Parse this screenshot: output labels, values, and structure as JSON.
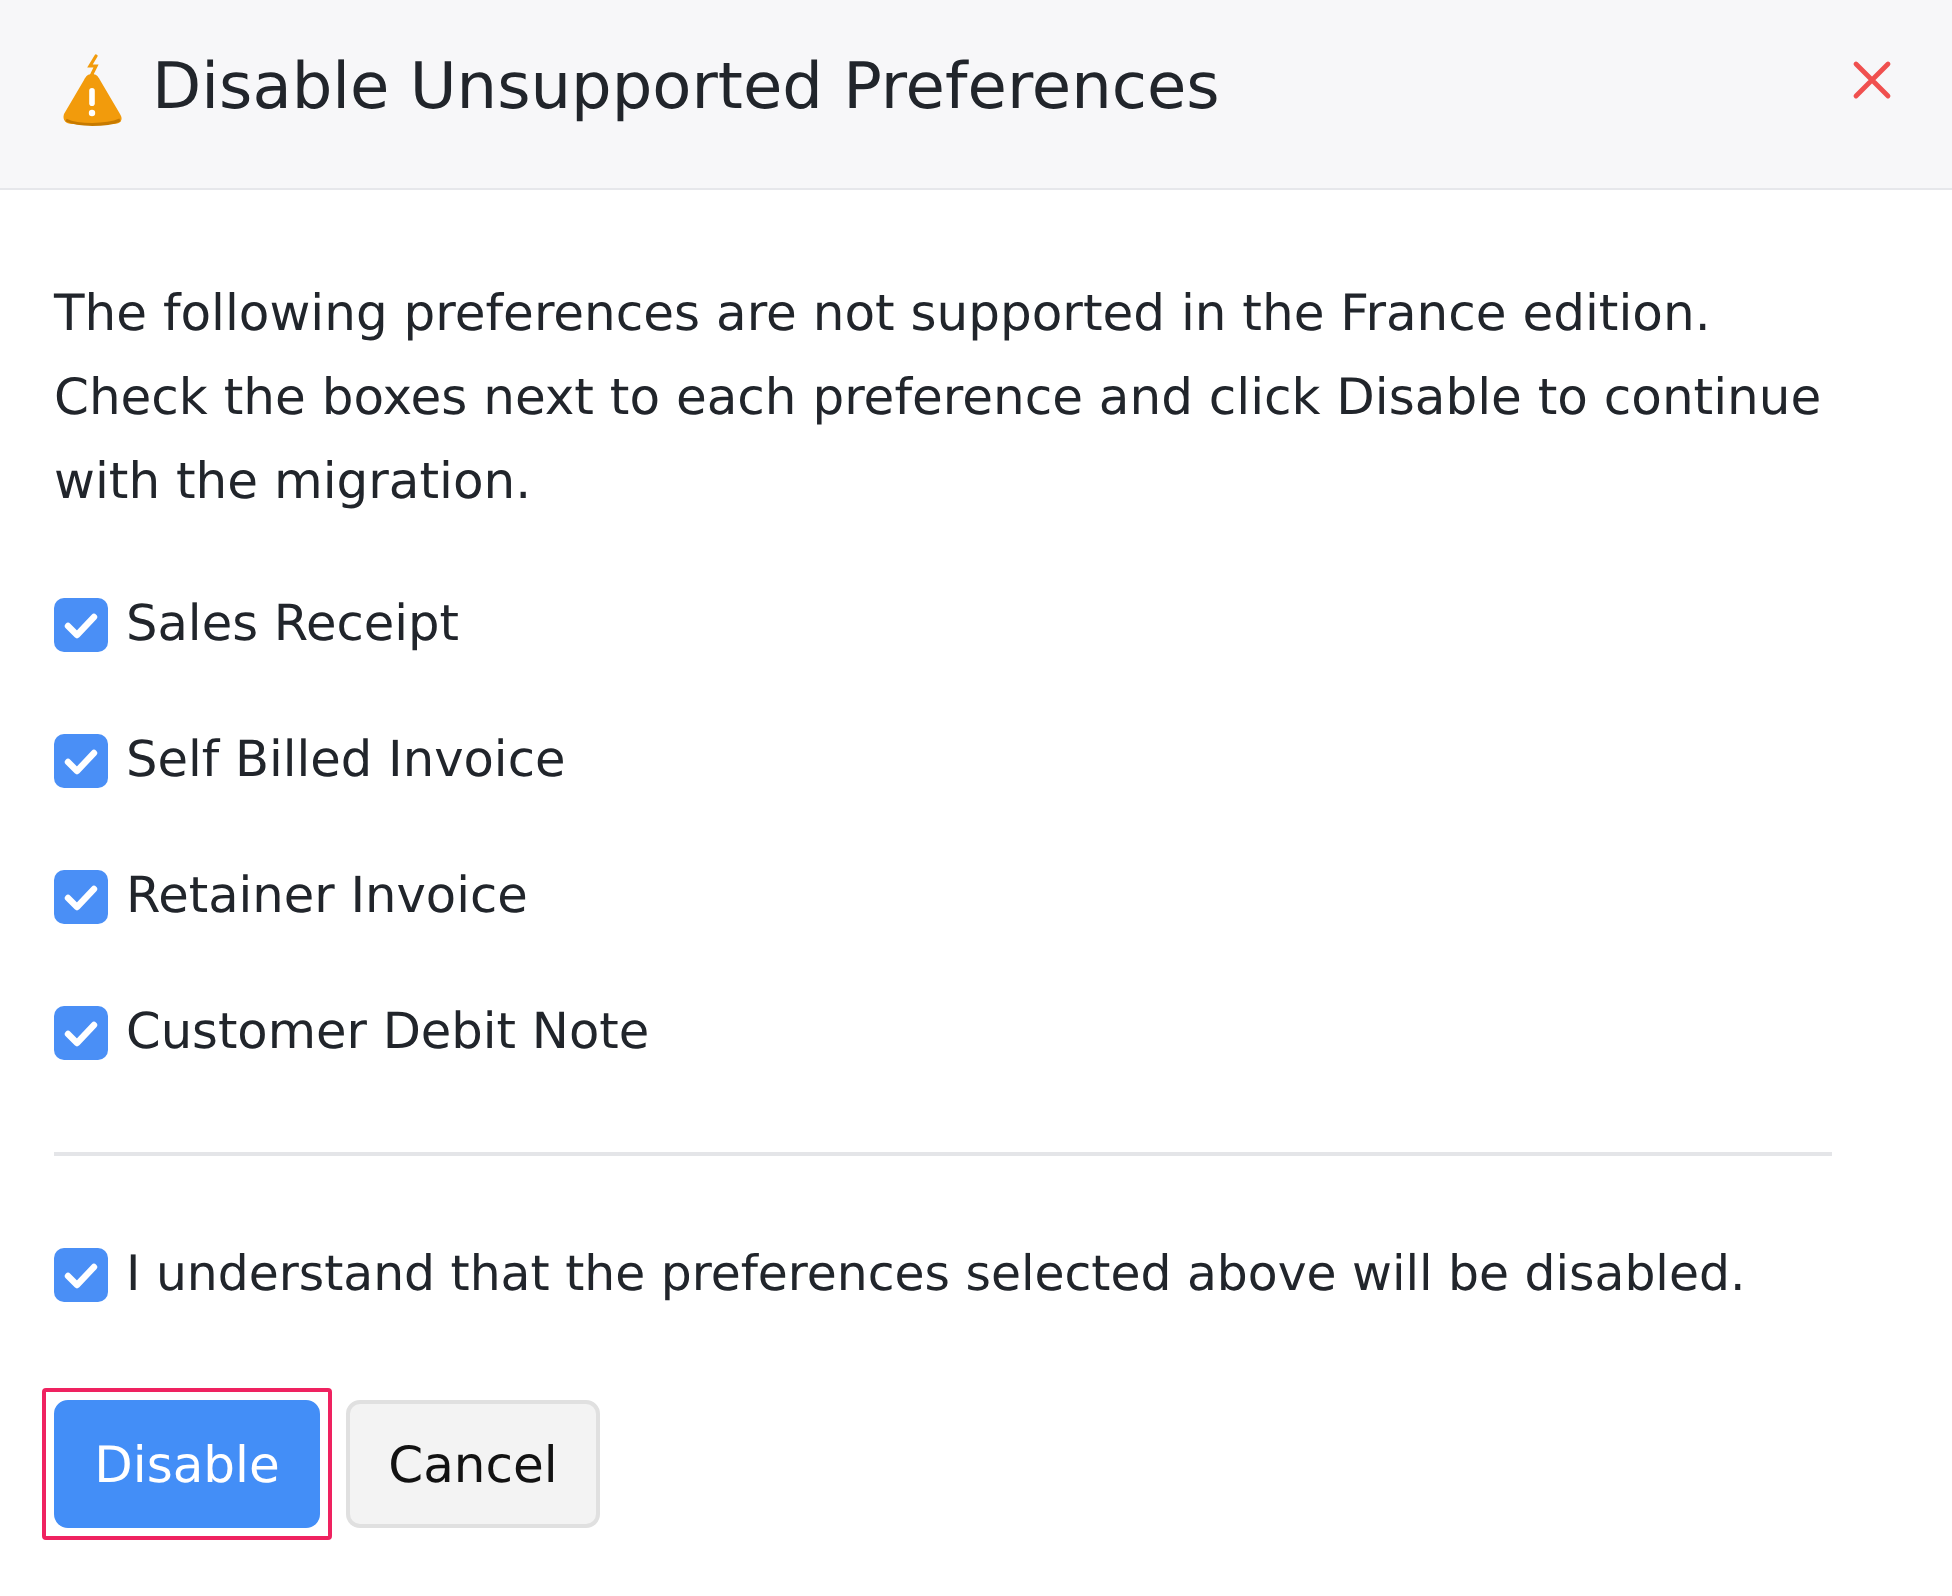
{
  "dialog": {
    "title": "Disable Unsupported Preferences"
  },
  "message": "The following preferences are not supported in the France edition. Check the boxes next to each preference and click Disable to continue with the migration.",
  "preferences": [
    {
      "label": "Sales Receipt",
      "checked": true
    },
    {
      "label": "Self Billed Invoice",
      "checked": true
    },
    {
      "label": "Retainer Invoice",
      "checked": true
    },
    {
      "label": "Customer Debit Note",
      "checked": true
    }
  ],
  "acknowledgement": {
    "label": "I understand that the preferences selected above will be disabled.",
    "checked": true
  },
  "buttons": [
    {
      "label": "Disable",
      "kind": "primary",
      "focused": true
    },
    {
      "label": "Cancel",
      "kind": "secondary",
      "focused": false
    }
  ]
}
